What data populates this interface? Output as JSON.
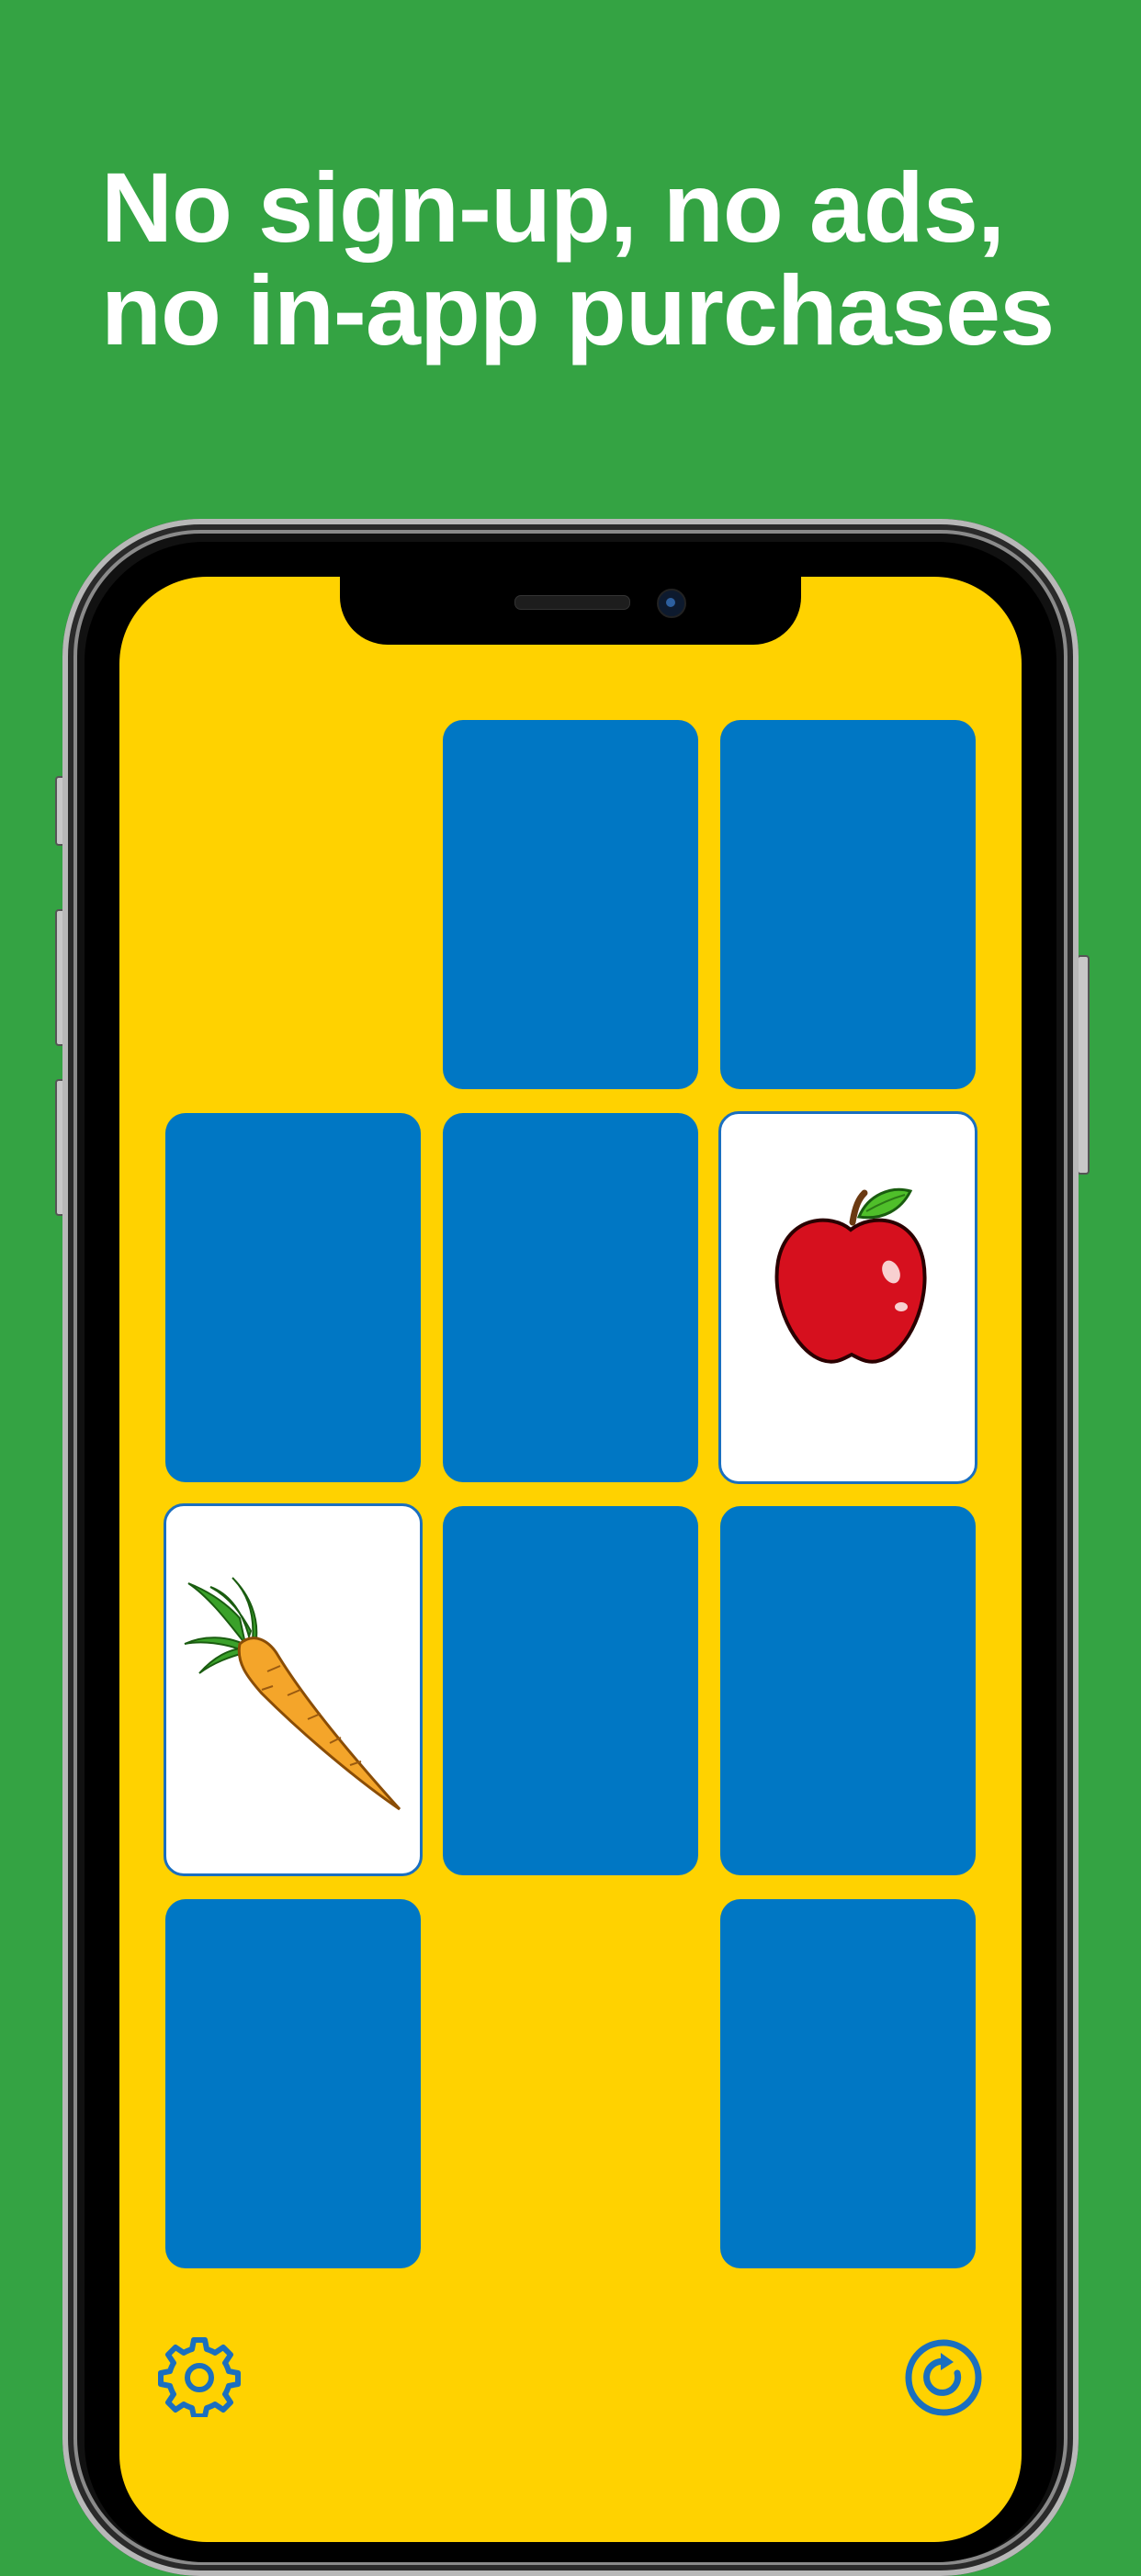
{
  "headline": {
    "line1": "No sign-up, no ads,",
    "line2": "no in-app purchases"
  },
  "colors": {
    "background": "#34a343",
    "screen": "#ffd200",
    "card_back": "#0077c4",
    "icon": "#1a6fc0"
  },
  "game": {
    "grid_rows": 4,
    "grid_cols": 3,
    "cards": [
      {
        "row": 1,
        "col": 2,
        "state": "face-down"
      },
      {
        "row": 1,
        "col": 3,
        "state": "face-down"
      },
      {
        "row": 2,
        "col": 1,
        "state": "face-down"
      },
      {
        "row": 2,
        "col": 2,
        "state": "face-down"
      },
      {
        "row": 2,
        "col": 3,
        "state": "face-up",
        "picture": "apple"
      },
      {
        "row": 3,
        "col": 1,
        "state": "face-up",
        "picture": "carrot"
      },
      {
        "row": 3,
        "col": 2,
        "state": "face-down"
      },
      {
        "row": 3,
        "col": 3,
        "state": "face-down"
      },
      {
        "row": 4,
        "col": 1,
        "state": "face-down"
      },
      {
        "row": 4,
        "col": 3,
        "state": "face-down"
      }
    ]
  },
  "controls": {
    "settings_icon": "gear-icon",
    "restart_icon": "restart-icon"
  }
}
